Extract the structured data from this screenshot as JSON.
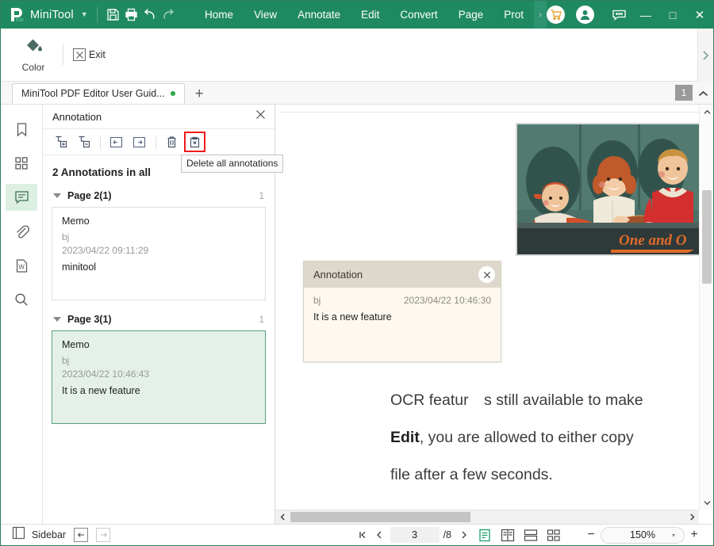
{
  "titlebar": {
    "brand": "MiniTool",
    "brand_caret": "▼",
    "quick_icons": [
      {
        "name": "save-icon",
        "title": "Save"
      },
      {
        "name": "print-icon",
        "title": "Print"
      },
      {
        "name": "undo-icon",
        "title": "Undo"
      },
      {
        "name": "redo-icon",
        "title": "Redo"
      }
    ],
    "menus": [
      "Home",
      "View",
      "Annotate",
      "Edit",
      "Convert",
      "Page",
      "Prot"
    ],
    "more_caret": "›",
    "window_controls": {
      "minimize": "—",
      "maximize": "□",
      "close": "✕"
    },
    "accent": "#1f8a62"
  },
  "ribbon": {
    "color_label": "Color",
    "exit_label": "Exit",
    "expand_caret": "›"
  },
  "tabbar": {
    "doc_tab": "MiniTool PDF Editor User Guid...",
    "new_tab": "+",
    "page_badge": "1",
    "collapse_caret": "^"
  },
  "rail": {
    "items": [
      {
        "name": "bookmark-icon",
        "label": "Bookmarks",
        "active": false
      },
      {
        "name": "thumbnails-icon",
        "label": "Page Thumbnails",
        "active": false
      },
      {
        "name": "annotation-icon",
        "label": "Annotation",
        "active": true
      },
      {
        "name": "attachment-icon",
        "label": "Attachments",
        "active": false
      },
      {
        "name": "word-icon",
        "label": "Layers",
        "active": false
      },
      {
        "name": "search-icon",
        "label": "Search",
        "active": false
      }
    ]
  },
  "annotation_panel": {
    "title": "Annotation",
    "tools": [
      {
        "name": "expand-all-icon",
        "label": "Expand all"
      },
      {
        "name": "collapse-all-icon",
        "label": "Collapse all"
      },
      {
        "name": "previous-annotation-icon",
        "label": "Previous"
      },
      {
        "name": "next-annotation-icon",
        "label": "Next"
      },
      {
        "name": "delete-annotation-icon",
        "label": "Delete"
      },
      {
        "name": "delete-all-annotations-icon",
        "label": "Delete all annotations"
      }
    ],
    "tooltip": "Delete all annotations",
    "count_text": "2 Annotations in all",
    "groups": [
      {
        "label": "Page 2(1)",
        "count": "1",
        "memo": {
          "title": "Memo",
          "author": "bj",
          "date": "2023/04/22 09:11:29",
          "body": "minitool",
          "selected": false
        }
      },
      {
        "label": "Page 3(1)",
        "count": "1",
        "memo": {
          "title": "Memo",
          "author": "bj",
          "date": "2023/04/22 10:46:43",
          "body": "It is a new feature",
          "selected": true
        }
      }
    ]
  },
  "document": {
    "popup": {
      "title": "Annotation",
      "author": "bj",
      "date": "2023/04/22 10:46:30",
      "body": "It is a new feature",
      "close": "✕"
    },
    "image_caption": "One and O",
    "lines": [
      {
        "prefix": "OCR featur",
        "suffix": "s still available to make"
      },
      {
        "bold": "Edit",
        "rest": ", you are allowed to either copy"
      },
      {
        "plain": "file after a few seconds."
      }
    ]
  },
  "statusbar": {
    "sidebar_label": "Sidebar",
    "back_arrow": "←",
    "forward_arrow": "→",
    "first_page": "|◁",
    "prev_page": "‹",
    "current_page": "3",
    "total_pages": "/8",
    "next_page": "›",
    "view_modes": [
      {
        "name": "single-page-view-icon",
        "active": true
      },
      {
        "name": "two-page-view-icon",
        "active": false
      },
      {
        "name": "continuous-view-icon",
        "active": false
      },
      {
        "name": "grid-view-icon",
        "active": false
      }
    ],
    "zoom_out": "−",
    "zoom_value": "150%",
    "zoom_caret": "▾",
    "zoom_in": "+"
  }
}
